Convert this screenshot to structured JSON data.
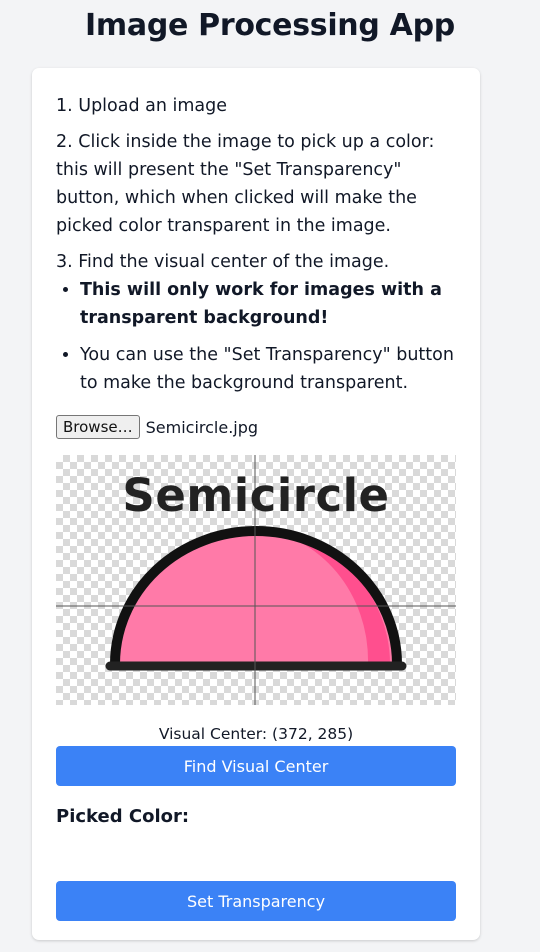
{
  "app": {
    "title": "Image Processing App"
  },
  "instructions": {
    "step1": "1. Upload an image",
    "step2": "2. Click inside the image to pick up a color: this will present the \"Set Transparency\" button, which when clicked will make the picked color transparent in the image.",
    "step3": "3. Find the visual center of the image.",
    "notes": [
      "This will only work for images with a transparent background!",
      "You can use the \"Set Transparency\" button to make the background transparent."
    ]
  },
  "file_input": {
    "button_label": "Browse…",
    "file_name": "Semicircle.jpg"
  },
  "preview": {
    "image_text": "Semicircle",
    "fill_color": "#ff7aa8",
    "shade_color": "#ff4f8e",
    "outline_color": "#111111",
    "checker_color": "#d9d9d9"
  },
  "visual_center": {
    "label": "Visual Center: (372, 285)"
  },
  "buttons": {
    "find_visual_center": "Find Visual Center",
    "set_transparency": "Set Transparency"
  },
  "picked_color": {
    "label": "Picked Color:"
  },
  "colors": {
    "accent": "#3b82f6",
    "background": "#f3f4f6",
    "card": "#ffffff"
  }
}
